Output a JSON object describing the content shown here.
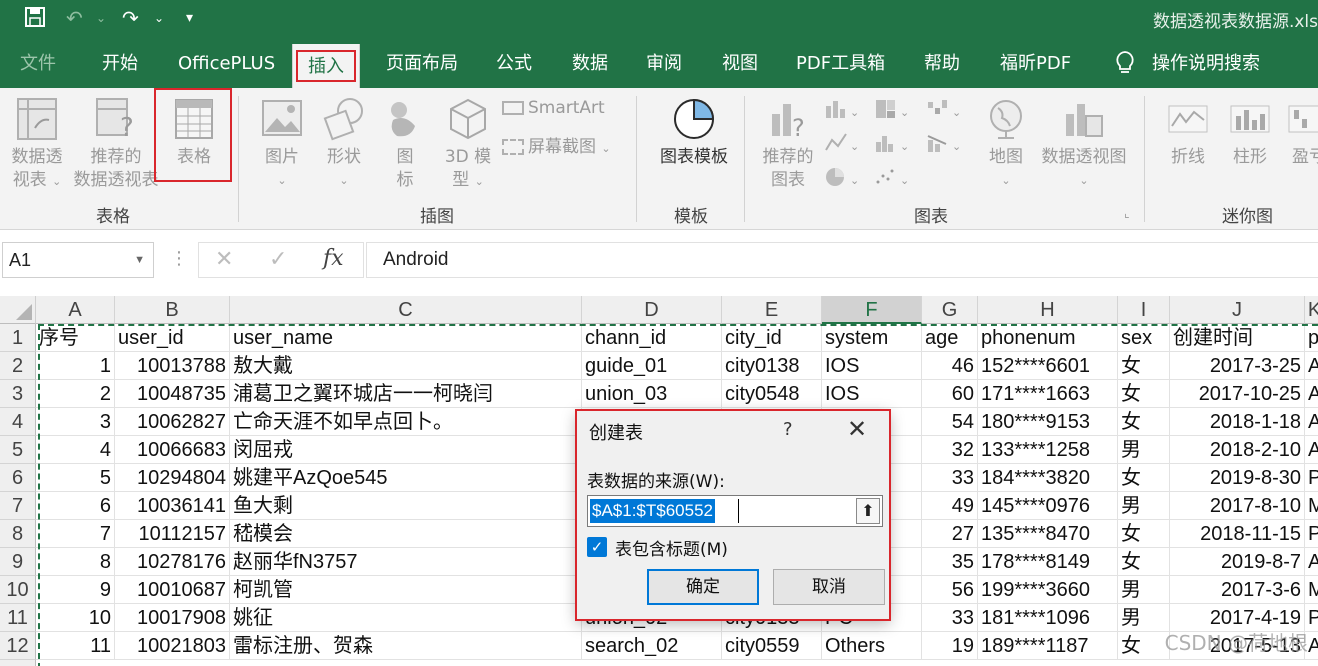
{
  "window": {
    "title": "数据透视表数据源.xls"
  },
  "tabs": [
    {
      "label": "文件"
    },
    {
      "label": "开始"
    },
    {
      "label": "OfficePLUS"
    },
    {
      "label": "插入"
    },
    {
      "label": "页面布局"
    },
    {
      "label": "公式"
    },
    {
      "label": "数据"
    },
    {
      "label": "审阅"
    },
    {
      "label": "视图"
    },
    {
      "label": "PDF工具箱"
    },
    {
      "label": "帮助"
    },
    {
      "label": "福昕PDF"
    }
  ],
  "tell_me": "操作说明搜索",
  "ribbon": {
    "pivot_table": [
      "数据透",
      "视表"
    ],
    "recommended_pivot": [
      "推荐的",
      "数据透视表"
    ],
    "table": "表格",
    "pictures": "图片",
    "shapes": "形状",
    "icons": [
      "图",
      "标"
    ],
    "models3d": [
      "3D 模",
      "型"
    ],
    "smartart": "SmartArt",
    "screenshot": "屏幕截图",
    "chart_template": "图表模板",
    "recommended_charts": [
      "推荐的",
      "图表"
    ],
    "maps": "地图",
    "pivot_chart": "数据透视图",
    "sparkline_line": "折线",
    "sparkline_column": "柱形",
    "sparkline_winloss": "盈亏",
    "groups": {
      "tables": "表格",
      "illustrations": "插图",
      "templates": "模板",
      "charts": "图表",
      "sparklines": "迷你图"
    }
  },
  "formula_bar": {
    "name_box": "A1",
    "fx": "fx",
    "content": "Android"
  },
  "columns": [
    {
      "letter": "A",
      "width": 79
    },
    {
      "letter": "B",
      "width": 115
    },
    {
      "letter": "C",
      "width": 352
    },
    {
      "letter": "D",
      "width": 140
    },
    {
      "letter": "E",
      "width": 100
    },
    {
      "letter": "F",
      "width": 100
    },
    {
      "letter": "G",
      "width": 56
    },
    {
      "letter": "H",
      "width": 140
    },
    {
      "letter": "I",
      "width": 52
    },
    {
      "letter": "J",
      "width": 135
    },
    {
      "letter": "K",
      "width": 20
    }
  ],
  "selected_column": "F",
  "header_row": [
    "序号",
    "user_id",
    "user_name",
    "chann_id",
    "city_id",
    "system",
    "age",
    "phonenum",
    "sex",
    "创建时间",
    "p"
  ],
  "rows": [
    [
      "1",
      "10013788",
      "敖大戴",
      "guide_01",
      "city0138",
      "IOS",
      "46",
      "152****6601",
      "女",
      "2017-3-25",
      "A"
    ],
    [
      "2",
      "10048735",
      "浦葛卫之翼环城店一一柯晓闫",
      "union_03",
      "city0548",
      "IOS",
      "60",
      "171****1663",
      "女",
      "2017-10-25",
      "A"
    ],
    [
      "3",
      "10062827",
      "亡命天涯不如早点回卜。",
      "",
      "",
      "d",
      "54",
      "180****9153",
      "女",
      "2018-1-18",
      "A"
    ],
    [
      "4",
      "10066683",
      "闵屈戎",
      "",
      "",
      "",
      "32",
      "133****1258",
      "男",
      "2018-2-10",
      "A"
    ],
    [
      "5",
      "10294804",
      "姚建平AzQoe545",
      "",
      "",
      "",
      "33",
      "184****3820",
      "女",
      "2019-8-30",
      "P"
    ],
    [
      "6",
      "10036141",
      "鱼大剩",
      "",
      "",
      "",
      "49",
      "145****0976",
      "男",
      "2017-8-10",
      "M"
    ],
    [
      "7",
      "10112157",
      "嵇模会",
      "",
      "",
      "",
      "27",
      "135****8470",
      "女",
      "2018-11-15",
      "P"
    ],
    [
      "8",
      "10278176",
      "赵丽华fN3757",
      "",
      "",
      "",
      "35",
      "178****8149",
      "女",
      "2019-8-7",
      "A"
    ],
    [
      "9",
      "10010687",
      "柯凯管",
      "",
      "",
      "",
      "56",
      "199****3660",
      "男",
      "2017-3-6",
      "M"
    ],
    [
      "10",
      "10017908",
      "姚征",
      "union_02",
      "city0133",
      "PC",
      "33",
      "181****1096",
      "男",
      "2017-4-19",
      "P"
    ],
    [
      "11",
      "10021803",
      "雷标注册、贺森",
      "search_02",
      "city0559",
      "Others",
      "19",
      "189****1187",
      "女",
      "2017-5-13",
      "A"
    ]
  ],
  "row_numbers": [
    "1",
    "2",
    "3",
    "4",
    "5",
    "6",
    "7",
    "8",
    "9",
    "10",
    "11",
    "12"
  ],
  "dialog": {
    "title": "创建表",
    "help": "?",
    "source_label": "表数据的来源(W):",
    "range_value": "$A$1:$T$60552",
    "checkbox_label": "表包含标题(M)",
    "checkbox_checked": true,
    "ok": "确定",
    "cancel": "取消"
  },
  "watermark": "CSDN @荷地根",
  "colors": {
    "brand": "#217346",
    "highlight": "#d9262c",
    "accent": "#0078d7"
  }
}
